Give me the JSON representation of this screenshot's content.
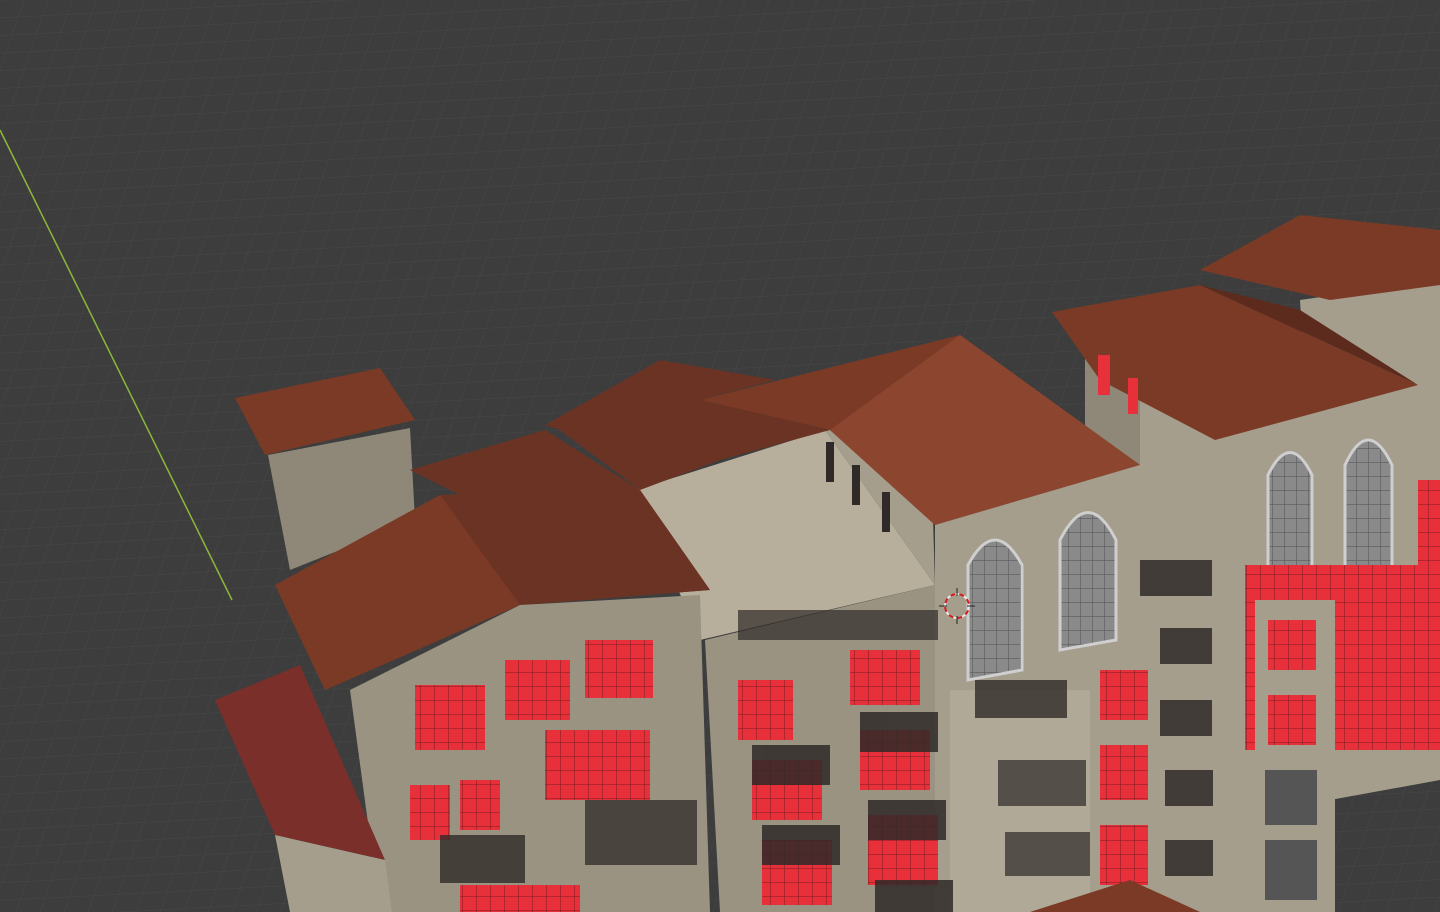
{
  "viewport": {
    "background": "#3d3d3d",
    "grid_color": "#4a4a4a",
    "y_axis_color": "#8ab83a",
    "objects": [
      {
        "name": "apartment-building-model",
        "kind": "mesh"
      },
      {
        "name": "3d-cursor",
        "kind": "cursor"
      }
    ]
  },
  "materials": {
    "roof": "#7a3a26",
    "roof_dark": "#5c2b1d",
    "roof_light": "#8c4630",
    "wall": "#a59e8d",
    "wall_dark": "#8f8878",
    "wall_top": "#b7af9c",
    "glass_selected": "#e8303a",
    "window_frame": "#6f6f6f",
    "rail": "#2f2a28",
    "slab": "#bdbdbd"
  }
}
